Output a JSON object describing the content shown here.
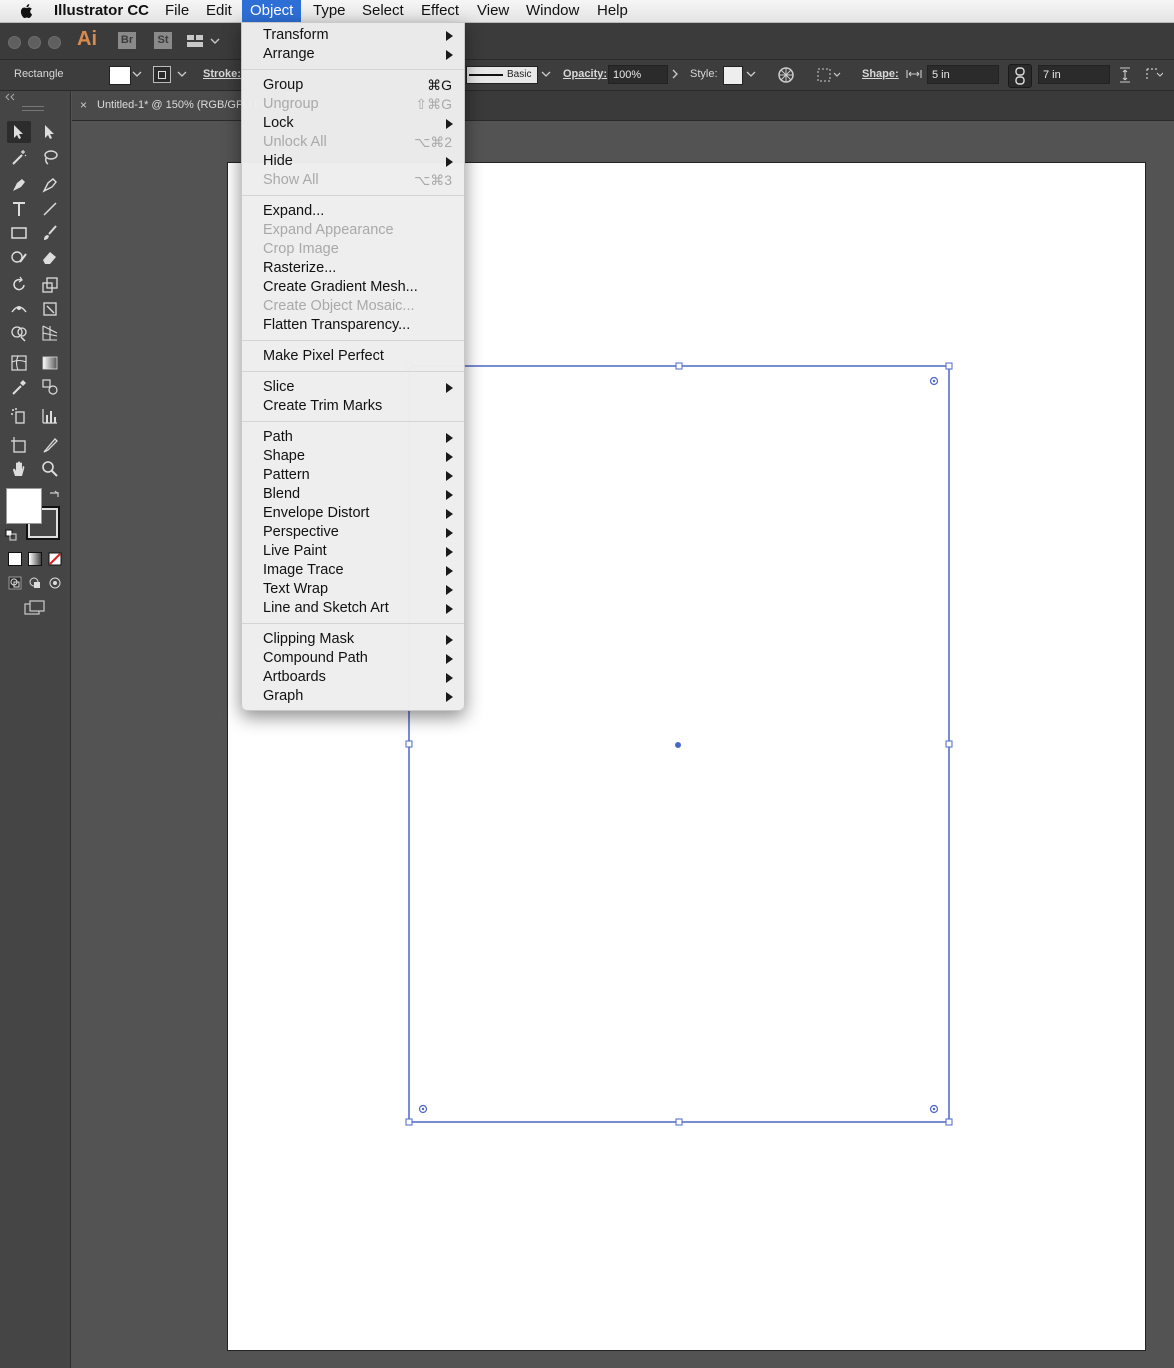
{
  "menubar": {
    "app_name": "Illustrator CC",
    "items": [
      "File",
      "Edit",
      "Object",
      "Type",
      "Select",
      "Effect",
      "View",
      "Window",
      "Help"
    ],
    "active": "Object"
  },
  "appbar": {
    "logo": "Ai",
    "bridge": "Br",
    "stock": "St"
  },
  "control": {
    "selection_label": "Rectangle",
    "stroke_label": "Stroke:",
    "brush_label": "Basic",
    "opacity_label": "Opacity:",
    "opacity_value": "100%",
    "style_label": "Style:",
    "shape_label": "Shape:",
    "width_value": "5 in",
    "height_value": "7 in"
  },
  "document": {
    "tab_title": "Untitled-1* @ 150% (RGB/GPU Preview)",
    "close_glyph": "×"
  },
  "object_menu": {
    "items": [
      {
        "label": "Transform",
        "submenu": true
      },
      {
        "label": "Arrange",
        "submenu": true
      },
      {
        "sep": true
      },
      {
        "label": "Group",
        "shortcut": "⌘G"
      },
      {
        "label": "Ungroup",
        "shortcut": "⇧⌘G",
        "disabled": true
      },
      {
        "label": "Lock",
        "submenu": true
      },
      {
        "label": "Unlock All",
        "shortcut": "⌥⌘2",
        "disabled": true
      },
      {
        "label": "Hide",
        "submenu": true
      },
      {
        "label": "Show All",
        "shortcut": "⌥⌘3",
        "disabled": true
      },
      {
        "sep": true
      },
      {
        "label": "Expand..."
      },
      {
        "label": "Expand Appearance",
        "disabled": true
      },
      {
        "label": "Crop Image",
        "disabled": true
      },
      {
        "label": "Rasterize..."
      },
      {
        "label": "Create Gradient Mesh..."
      },
      {
        "label": "Create Object Mosaic...",
        "disabled": true
      },
      {
        "label": "Flatten Transparency..."
      },
      {
        "sep": true
      },
      {
        "label": "Make Pixel Perfect"
      },
      {
        "sep": true
      },
      {
        "label": "Slice",
        "submenu": true
      },
      {
        "label": "Create Trim Marks"
      },
      {
        "sep": true
      },
      {
        "label": "Path",
        "submenu": true
      },
      {
        "label": "Shape",
        "submenu": true
      },
      {
        "label": "Pattern",
        "submenu": true
      },
      {
        "label": "Blend",
        "submenu": true
      },
      {
        "label": "Envelope Distort",
        "submenu": true
      },
      {
        "label": "Perspective",
        "submenu": true
      },
      {
        "label": "Live Paint",
        "submenu": true
      },
      {
        "label": "Image Trace",
        "submenu": true
      },
      {
        "label": "Text Wrap",
        "submenu": true
      },
      {
        "label": "Line and Sketch Art",
        "submenu": true
      },
      {
        "sep": true
      },
      {
        "label": "Clipping Mask",
        "submenu": true
      },
      {
        "label": "Compound Path",
        "submenu": true
      },
      {
        "label": "Artboards",
        "submenu": true
      },
      {
        "label": "Graph",
        "submenu": true
      }
    ]
  },
  "colors": {
    "selection": "#4a67c8",
    "menu_highlight": "#2e6fd6",
    "canvas_bg": "#535353",
    "logo": "#d98a4e"
  }
}
